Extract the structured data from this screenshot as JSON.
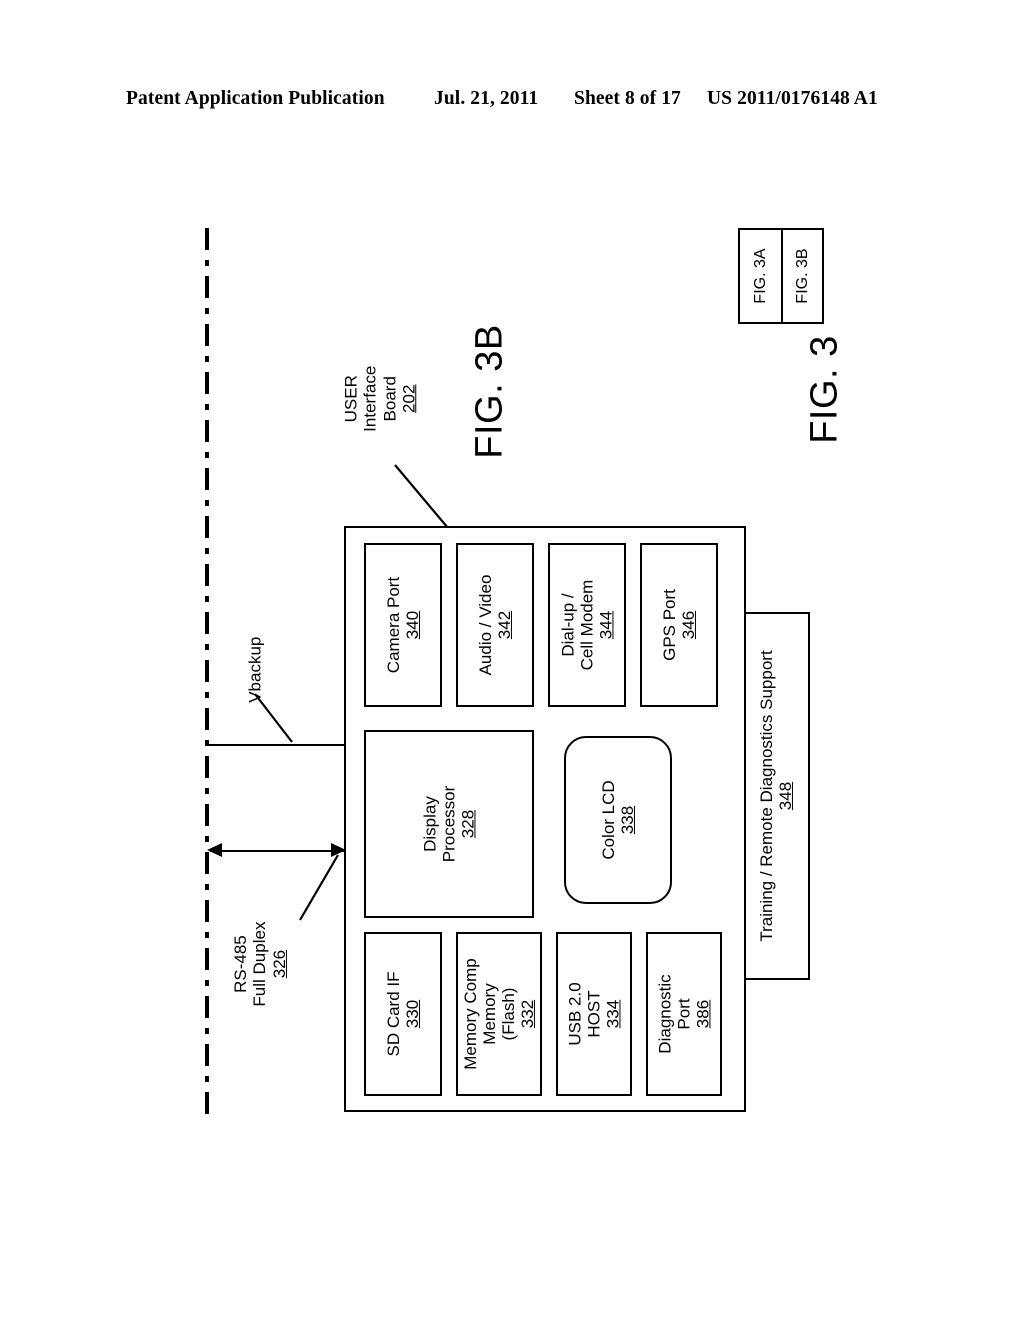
{
  "header": {
    "publication": "Patent Application Publication",
    "date": "Jul. 21, 2011",
    "sheet": "Sheet 8 of 17",
    "doc_number": "US 2011/0176148 A1"
  },
  "figure": {
    "caption_main": "FIG. 3B",
    "caption_key": "FIG. 3",
    "key_cells": [
      "FIG. 3A",
      "FIG. 3B"
    ],
    "board_label": {
      "line1": "USER",
      "line2": "Interface",
      "line3": "Board",
      "num": "202"
    }
  },
  "signals": {
    "vbackup": {
      "label": "Vbackup"
    },
    "rs485": {
      "line1": "RS-485",
      "line2": "Full Duplex",
      "num": "326"
    }
  },
  "blocks": {
    "top_row": [
      {
        "name": "camera-port",
        "line1": "Camera Port",
        "num": "340"
      },
      {
        "name": "audio-video",
        "line1": "Audio / Video",
        "num": "342"
      },
      {
        "name": "dialup-cell-modem",
        "line1": "Dial-up /",
        "line2": "Cell Modem",
        "num": "344"
      },
      {
        "name": "gps-port",
        "line1": "GPS Port",
        "num": "346"
      }
    ],
    "middle_row": [
      {
        "name": "display-processor",
        "line1": "Display",
        "line2": "Processor",
        "num": "328"
      },
      {
        "name": "color-lcd",
        "line1": "Color LCD",
        "num": "338"
      }
    ],
    "bottom_row": [
      {
        "name": "sd-card-if",
        "line1": "SD Card IF",
        "num": "330"
      },
      {
        "name": "memory-comp-memory-flash",
        "line1": "Memory Comp",
        "line2": "Memory",
        "line3": "(Flash)",
        "num": "332"
      },
      {
        "name": "usb-host",
        "line1": "USB 2.0",
        "line2": "HOST",
        "num": "334"
      },
      {
        "name": "diagnostic-port",
        "line1": "Diagnostic",
        "line2": "Port",
        "num": "386"
      }
    ],
    "external": [
      {
        "name": "training-remote-diagnostics-support",
        "line1": "Training / Remote Diagnostics Support",
        "num": "348"
      }
    ]
  }
}
